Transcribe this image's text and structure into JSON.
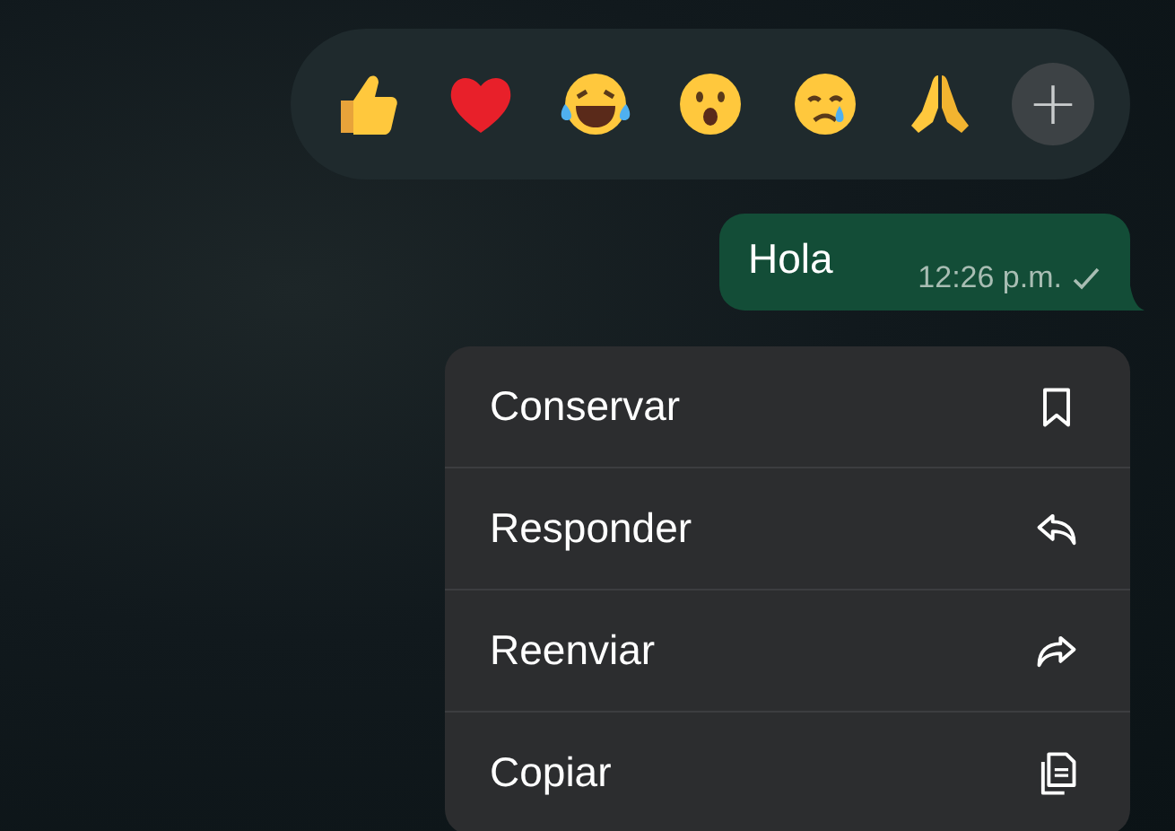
{
  "reactions": [
    {
      "kind": "thumbs-up"
    },
    {
      "kind": "heart"
    },
    {
      "kind": "laughing"
    },
    {
      "kind": "surprised"
    },
    {
      "kind": "crying"
    },
    {
      "kind": "praying"
    }
  ],
  "more_reactions": {
    "label": "+"
  },
  "message": {
    "text": "Hola",
    "time": "12:26 p.m.",
    "read": false
  },
  "menu": [
    {
      "label": "Conservar",
      "kind": "bookmark"
    },
    {
      "label": "Responder",
      "kind": "reply"
    },
    {
      "label": "Reenviar",
      "kind": "forward"
    },
    {
      "label": "Copiar",
      "kind": "copy"
    }
  ]
}
